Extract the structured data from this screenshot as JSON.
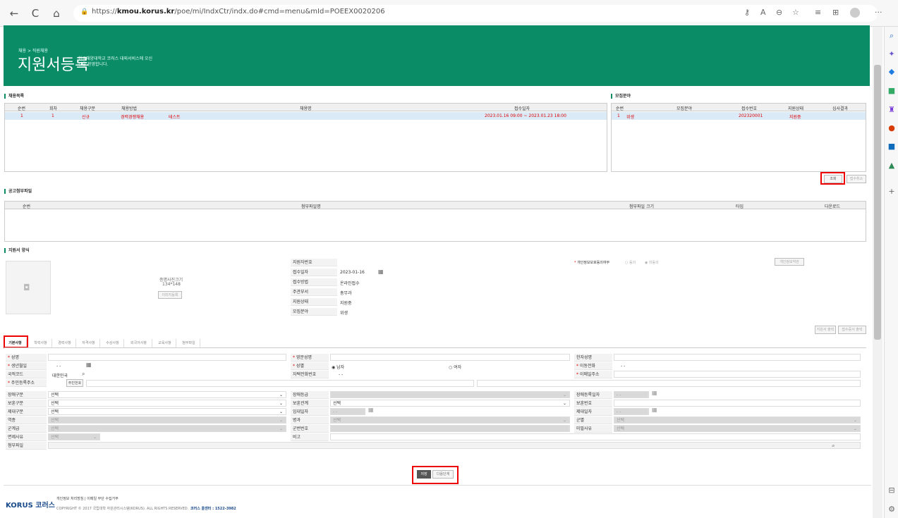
{
  "browser": {
    "url_prefix": "https://",
    "url_host": "kmou.korus.kr",
    "url_path": "/poe/mi/IndxCtr/indx.do#cmd=menu&mId=POEEX0020206",
    "back": "←",
    "refresh": "C",
    "home": "⌂",
    "more": "···"
  },
  "banner": {
    "breadcrumb": "채용 > 직원채용",
    "title": "지원서등록",
    "desc": "한국해양대학교 코러스 대외서비스에 오신 것을 환영합니다."
  },
  "recruit": {
    "section": "채용목록",
    "headers": [
      "순번",
      "회차",
      "채용구분",
      "채용방법",
      "채용명",
      "접수일자"
    ],
    "row": [
      "1",
      "1",
      "신규",
      "경력경쟁채용",
      "테스트",
      "2023.01.16 09:00 ~ 2023.01.23 18:00"
    ]
  },
  "field": {
    "section": "모집분야",
    "headers": [
      "순번",
      "모집분야",
      "접수번호",
      "지원상태",
      "심사결과"
    ],
    "row": [
      "1",
      "위생",
      "202320001",
      "지원중",
      ""
    ]
  },
  "buttons": {
    "search": "조회",
    "cancel_apply": "접수취소",
    "print_app": "지원서 출력",
    "print_receipt": "접수증서 출력",
    "save": "저장",
    "next": "다음단계",
    "photo_reg": "이미지등록",
    "privacy_terms": "개인정보약관",
    "resident_no": "주민번호"
  },
  "notice": {
    "section": "공고첨부파일",
    "headers": [
      "순번",
      "첨부파일명",
      "첨부파일 크기",
      "타입",
      "다운로드"
    ]
  },
  "appform": {
    "section": "지원서 양식",
    "photo_size": "증명사진크기",
    "photo_dim": "134*148",
    "labels": [
      "지원자번호",
      "접수일자",
      "접수방법",
      "주관부서",
      "지원상태",
      "모집분야"
    ],
    "values": [
      "",
      "2023-01-16",
      "온라인접수",
      "총무과",
      "지원중",
      "위생"
    ],
    "privacy_label": "개인정보보호동의여부",
    "agree": "동의",
    "disagree": "미동의"
  },
  "tabs": [
    "기본사항",
    "학력사항",
    "경력사항",
    "자격사항",
    "수상사항",
    "외국어사항",
    "교육사항",
    "첨부파일"
  ],
  "form": {
    "name": "성명",
    "eng_name": "영문성명",
    "hanja_name": "한자성명",
    "birth": "생년월일",
    "birth_val": "- -",
    "gender": "성별",
    "male": "남자",
    "female": "여자",
    "mobile": "이동전화",
    "mobile_val": "- -",
    "nation": "국적코드",
    "nation_val": "대한민국",
    "home_phone": "자택전화번호",
    "home_phone_val": "- -",
    "email": "이메일주소",
    "address": "주민등록주소",
    "disability": "장애구분",
    "disability_grade": "장애등급",
    "disability_date": "장애등록일자",
    "date_ph": "- -",
    "veteran": "보훈구분",
    "veteran_rel": "보훈관계",
    "veteran_no": "보훈번호",
    "military_type": "제대구분",
    "enlist_date": "입대일자",
    "discharge_date": "제대일자",
    "service": "역종",
    "branch": "병과",
    "rank_type": "군별",
    "rank": "군계급",
    "service_no": "군번번호",
    "exempt_reason": "미필사유",
    "exemption": "면제사유",
    "note": "비고",
    "attach": "첨부파일",
    "select": "선택"
  },
  "footer": {
    "logo": "KORUS 코러스",
    "links": "개인정보 처리방침  |  이메일 무단 수집거부",
    "copyright": "COPYRIGHT © 2017 국립대학 자원관리시스템(KORUS). ALL RIGHTS RESERVED.",
    "center": "코러스 콜센터 : 1522-3982"
  }
}
